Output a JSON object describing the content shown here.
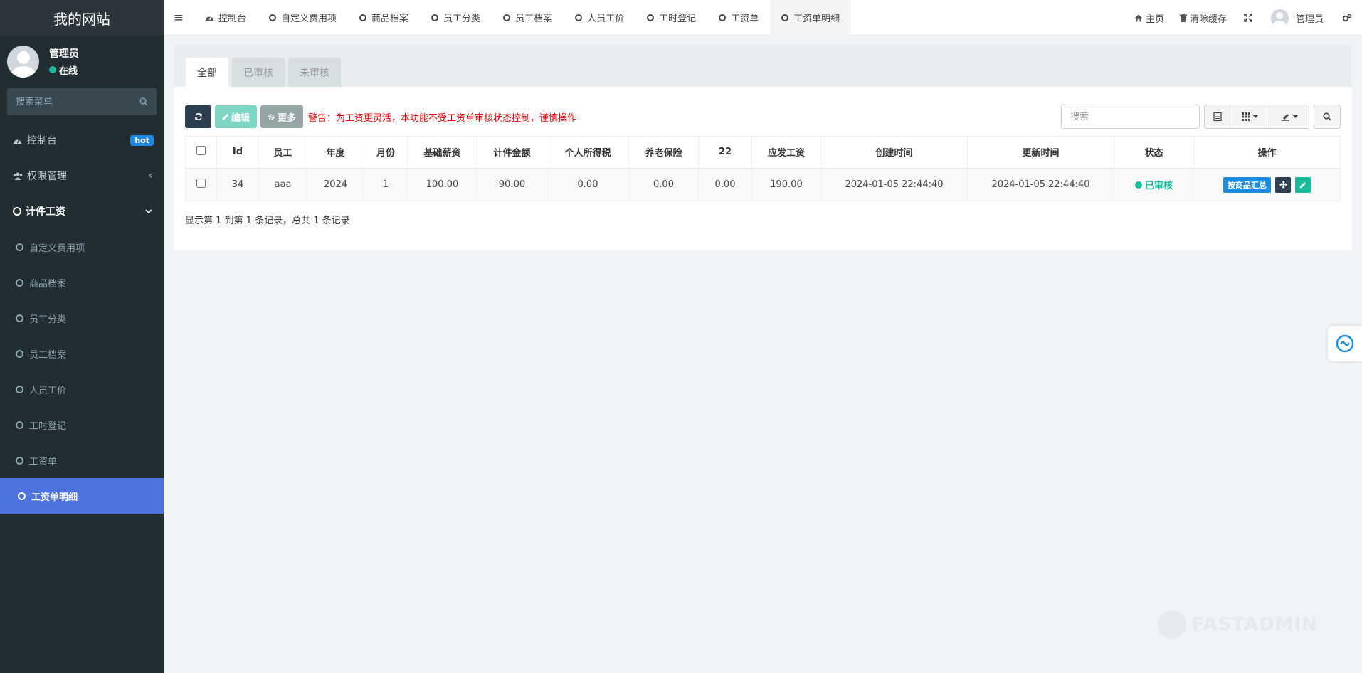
{
  "brand": {
    "title": "我的网站"
  },
  "user": {
    "name": "管理员",
    "status": "在线"
  },
  "sidebar": {
    "search_placeholder": "搜索菜单",
    "items": [
      {
        "label": "控制台",
        "badge": "hot"
      },
      {
        "label": "权限管理"
      },
      {
        "label": "计件工资"
      }
    ],
    "subitems": [
      {
        "label": "自定义费用项"
      },
      {
        "label": "商品档案"
      },
      {
        "label": "员工分类"
      },
      {
        "label": "员工档案"
      },
      {
        "label": "人员工价"
      },
      {
        "label": "工时登记"
      },
      {
        "label": "工资单"
      },
      {
        "label": "工资单明细"
      }
    ]
  },
  "topbar": {
    "tabs": [
      {
        "label": "控制台",
        "icon": "dashboard-icon"
      },
      {
        "label": "自定义费用项",
        "icon": "circle-icon"
      },
      {
        "label": "商品档案",
        "icon": "circle-icon"
      },
      {
        "label": "员工分类",
        "icon": "circle-icon"
      },
      {
        "label": "员工档案",
        "icon": "circle-icon"
      },
      {
        "label": "人员工价",
        "icon": "circle-icon"
      },
      {
        "label": "工时登记",
        "icon": "circle-icon"
      },
      {
        "label": "工资单",
        "icon": "circle-icon"
      },
      {
        "label": "工资单明细",
        "icon": "circle-icon"
      }
    ],
    "home": "主页",
    "clear_cache": "清除缓存",
    "user": "管理员"
  },
  "panel": {
    "tabs": [
      "全部",
      "已审核",
      "未审核"
    ],
    "toolbar": {
      "edit": "编辑",
      "more": "更多",
      "warning": "警告：为工资更灵活，本功能不受工资单审核状态控制，谨慎操作",
      "search_placeholder": "搜索"
    },
    "table": {
      "headers": [
        "Id",
        "员工",
        "年度",
        "月份",
        "基础薪资",
        "计件金额",
        "个人所得税",
        "养老保险",
        "22",
        "应发工资",
        "创建时间",
        "更新时间",
        "状态",
        "操作"
      ],
      "rows": [
        {
          "id": "34",
          "employee": "aaa",
          "year": "2024",
          "month": "1",
          "base": "100.00",
          "piece": "90.00",
          "tax": "0.00",
          "pension": "0.00",
          "c22": "0.00",
          "gross": "190.00",
          "created": "2024-01-05 22:44:40",
          "updated": "2024-01-05 22:44:40",
          "status": "已审核",
          "op_summary": "按商品汇总"
        }
      ]
    },
    "footer": "显示第 1 到第 1 条记录，总共 1 条记录"
  },
  "watermark": "FASTADMIN",
  "colors": {
    "sidebar_bg": "#222d32",
    "active_menu": "#4e73df",
    "success": "#18bc9c",
    "danger": "#e00000",
    "primary": "#1b8ee4"
  }
}
